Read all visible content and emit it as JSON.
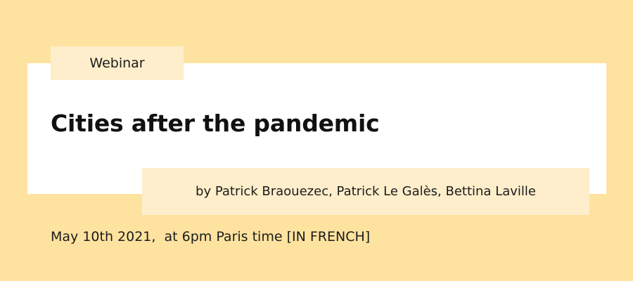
{
  "event": {
    "tag": "Webinar",
    "title": "Cities after the pandemic",
    "authors": "by Patrick Braouezec, Patrick Le Galès, Bettina Laville",
    "datetime": "May 10th 2021,  at 6pm Paris time [IN FRENCH]"
  },
  "colors": {
    "background": "#fee29f",
    "card": "#ffffff",
    "label_box": "#feeecb",
    "text": "#1c1c1c"
  }
}
